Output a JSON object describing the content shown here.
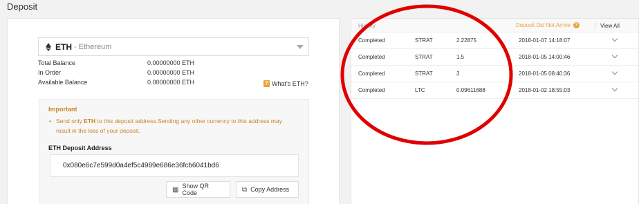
{
  "page": {
    "title": "Deposit"
  },
  "currency": {
    "code": "ETH",
    "separator": "-",
    "name": "Ethereum"
  },
  "balances": [
    {
      "label": "Total Balance",
      "value": "0.00000000 ETH"
    },
    {
      "label": "In Order",
      "value": "0.00000000 ETH"
    },
    {
      "label": "Available Balance",
      "value": "0.00000000 ETH"
    }
  ],
  "whats_link": "What's ETH?",
  "important": {
    "title": "Important",
    "text_before": "Send only ",
    "text_bold": "ETH",
    "text_after": " to this deposit address.Sending any other currency to this address may result in the loss of your deposit."
  },
  "deposit": {
    "address_label": "ETH Deposit Address",
    "address": "0x080e6c7e599d0a4ef5c4989e686e36fcb6041bd6",
    "qr_button": "Show QR Code",
    "copy_button": "Copy Address"
  },
  "history": {
    "title": "History",
    "not_arrive": "Deposit Did Not Arrive",
    "view_all": "View All",
    "rows": [
      {
        "status": "Completed",
        "coin": "STRAT",
        "amount": "2.22875",
        "date": "2018-01-07 14:18:07"
      },
      {
        "status": "Completed",
        "coin": "STRAT",
        "amount": "1.5",
        "date": "2018-01-05 14:00:46"
      },
      {
        "status": "Completed",
        "coin": "STRAT",
        "amount": "3",
        "date": "2018-01-05 08:40:36"
      },
      {
        "status": "Completed",
        "coin": "LTC",
        "amount": "0.09611688",
        "date": "2018-01-02 18:55:03"
      }
    ]
  },
  "colors": {
    "accent": "#e8a33b",
    "warning_text": "#c8852b",
    "annotation": "#e00000"
  },
  "icons": [
    "ethereum-icon",
    "question-icon",
    "qr-code-icon",
    "copy-icon",
    "chevron-down-icon"
  ]
}
